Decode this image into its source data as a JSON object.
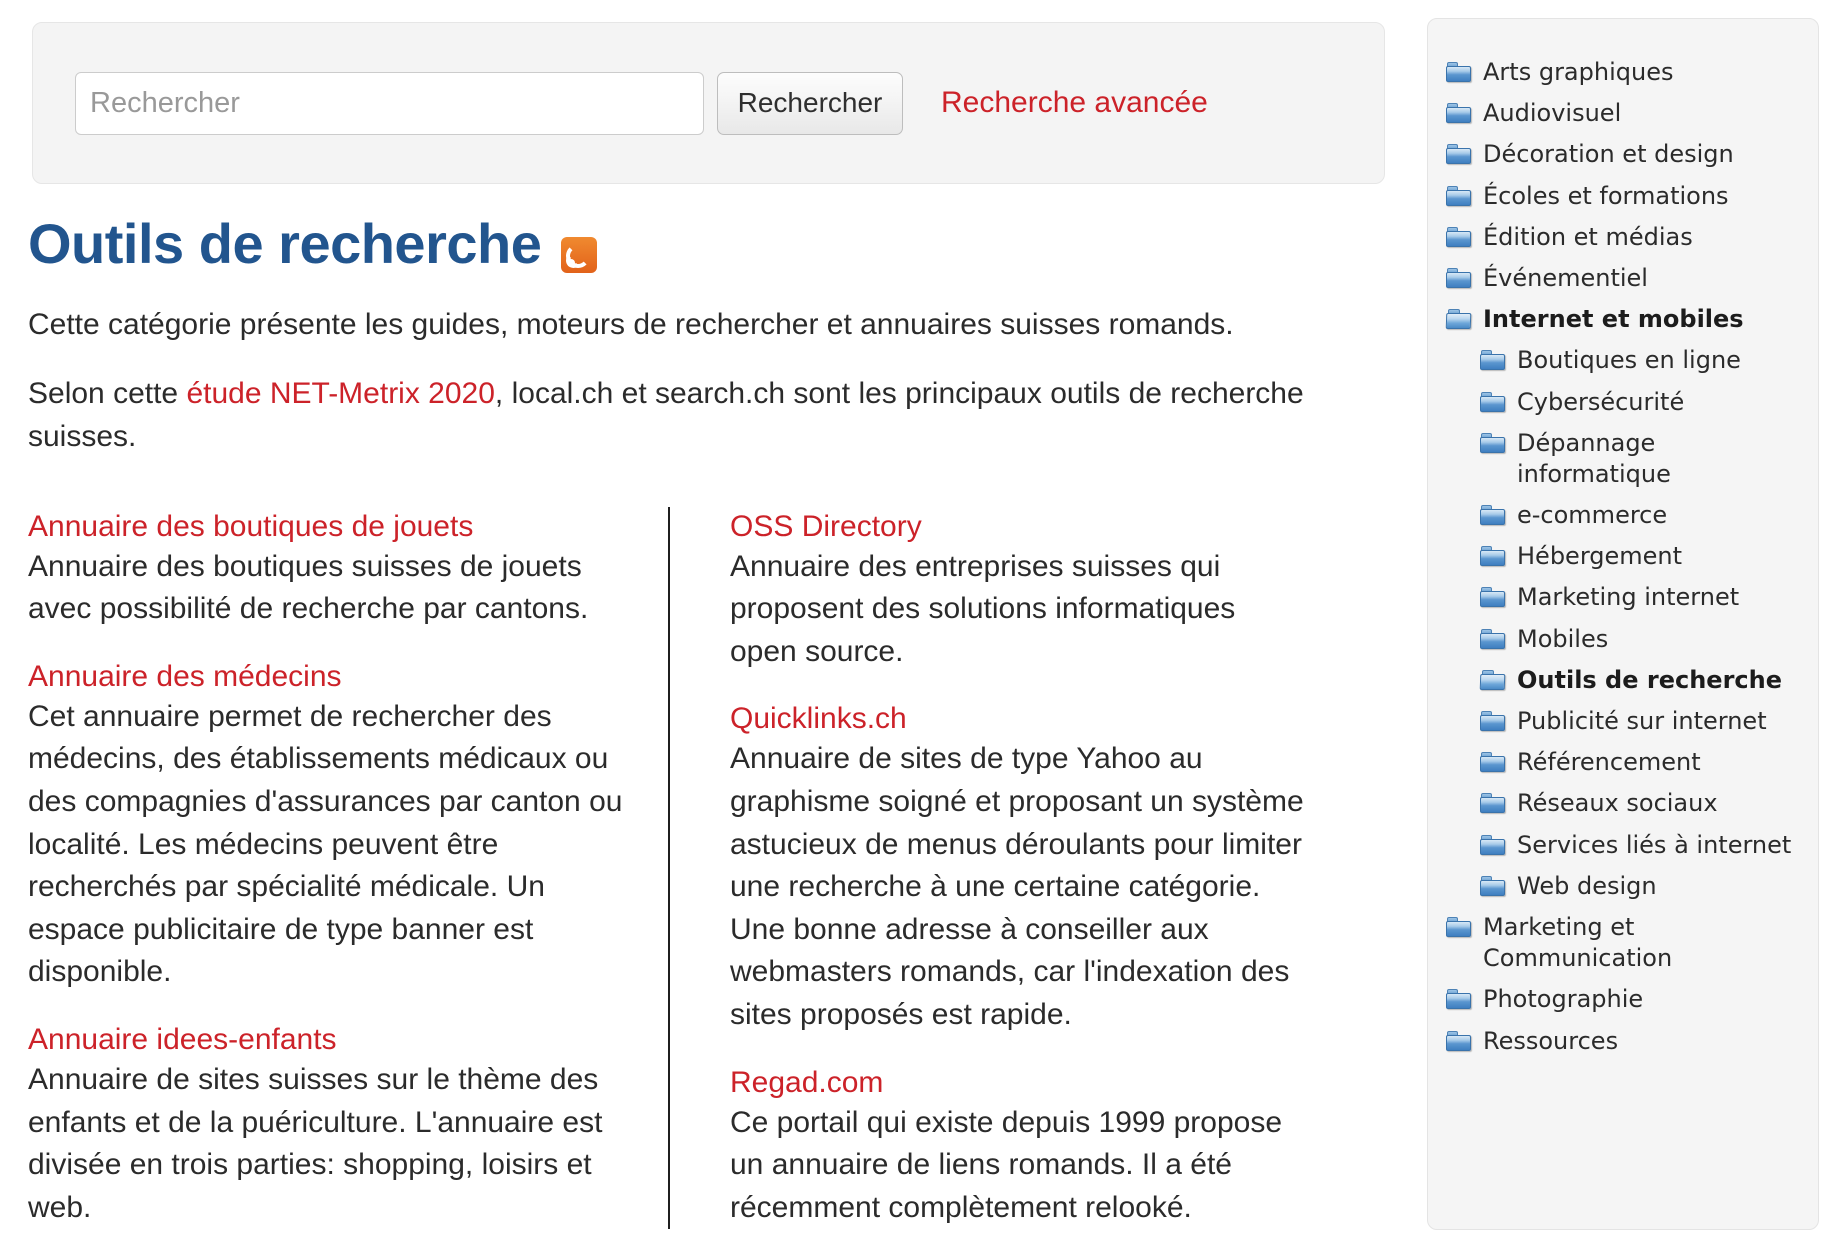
{
  "search": {
    "placeholder": "Rechercher",
    "value": "",
    "submit_label": "Rechercher",
    "advanced_label": "Recherche avancée"
  },
  "page": {
    "title": "Outils de recherche",
    "rss_icon": "rss-feed-icon",
    "title_color": "#22558e",
    "link_color": "#cc2229",
    "intro_1": "Cette catégorie présente les guides, moteurs de rechercher et annuaires suisses romands.",
    "intro_2_before": "Selon cette ",
    "intro_2_link": "étude NET-Metrix 2020",
    "intro_2_after": ", local.ch et search.ch sont les principaux outils de recherche suisses."
  },
  "listings": {
    "left": [
      {
        "title": "Annuaire des boutiques de jouets",
        "description": "Annuaire des boutiques suisses de jouets avec possibilité de recherche par cantons."
      },
      {
        "title": "Annuaire des médecins",
        "description": "Cet annuaire permet de rechercher des médecins, des établissements médicaux ou des compagnies d'assurances par canton ou localité. Les médecins peuvent être recherchés par spécialité médicale. Un espace publicitaire de type banner est disponible."
      },
      {
        "title": "Annuaire idees-enfants",
        "description": "Annuaire de sites suisses sur le thème des enfants et de la puériculture. L'annuaire est divisée en trois parties: shopping, loisirs et web."
      }
    ],
    "right": [
      {
        "title": "OSS Directory",
        "description": "Annuaire des entreprises suisses qui proposent des solutions informatiques open source."
      },
      {
        "title": "Quicklinks.ch",
        "description": "Annuaire de sites de type Yahoo au graphisme soigné et proposant un système astucieux de menus déroulants pour limiter une recherche à une certaine catégorie. Une bonne adresse à conseiller aux webmasters romands, car l'indexation des sites proposés est rapide."
      },
      {
        "title": "Regad.com",
        "description": "Ce portail qui existe depuis 1999 propose un annuaire de liens romands. Il a été récemment complètement relooké."
      }
    ]
  },
  "sidebar": {
    "icon": "folder-icon",
    "open_icon": "folder-open-icon",
    "items": [
      {
        "label": "Arts graphiques",
        "state": "closed",
        "current": false
      },
      {
        "label": "Audiovisuel",
        "state": "closed",
        "current": false
      },
      {
        "label": "Décoration et design",
        "state": "closed",
        "current": false
      },
      {
        "label": "Écoles et formations",
        "state": "closed",
        "current": false
      },
      {
        "label": "Édition et médias",
        "state": "closed",
        "current": false
      },
      {
        "label": "Événementiel",
        "state": "closed",
        "current": false
      },
      {
        "label": "Internet et mobiles",
        "state": "open",
        "current": true
      },
      {
        "label": "Marketing et Communication",
        "state": "closed",
        "current": false
      },
      {
        "label": "Photographie",
        "state": "closed",
        "current": false
      },
      {
        "label": "Ressources",
        "state": "closed",
        "current": false
      }
    ],
    "children": [
      {
        "label": "Boutiques en ligne",
        "state": "closed",
        "current": false
      },
      {
        "label": "Cybersécurité",
        "state": "closed",
        "current": false
      },
      {
        "label": "Dépannage informatique",
        "state": "closed",
        "current": false
      },
      {
        "label": "e-commerce",
        "state": "closed",
        "current": false
      },
      {
        "label": "Hébergement",
        "state": "closed",
        "current": false
      },
      {
        "label": "Marketing internet",
        "state": "closed",
        "current": false
      },
      {
        "label": "Mobiles",
        "state": "closed",
        "current": false
      },
      {
        "label": "Outils de recherche",
        "state": "open",
        "current": true
      },
      {
        "label": "Publicité sur internet",
        "state": "closed",
        "current": false
      },
      {
        "label": "Référencement",
        "state": "closed",
        "current": false
      },
      {
        "label": "Réseaux sociaux",
        "state": "closed",
        "current": false
      },
      {
        "label": "Services liés à internet",
        "state": "closed",
        "current": false
      },
      {
        "label": "Web design",
        "state": "closed",
        "current": false
      }
    ]
  }
}
